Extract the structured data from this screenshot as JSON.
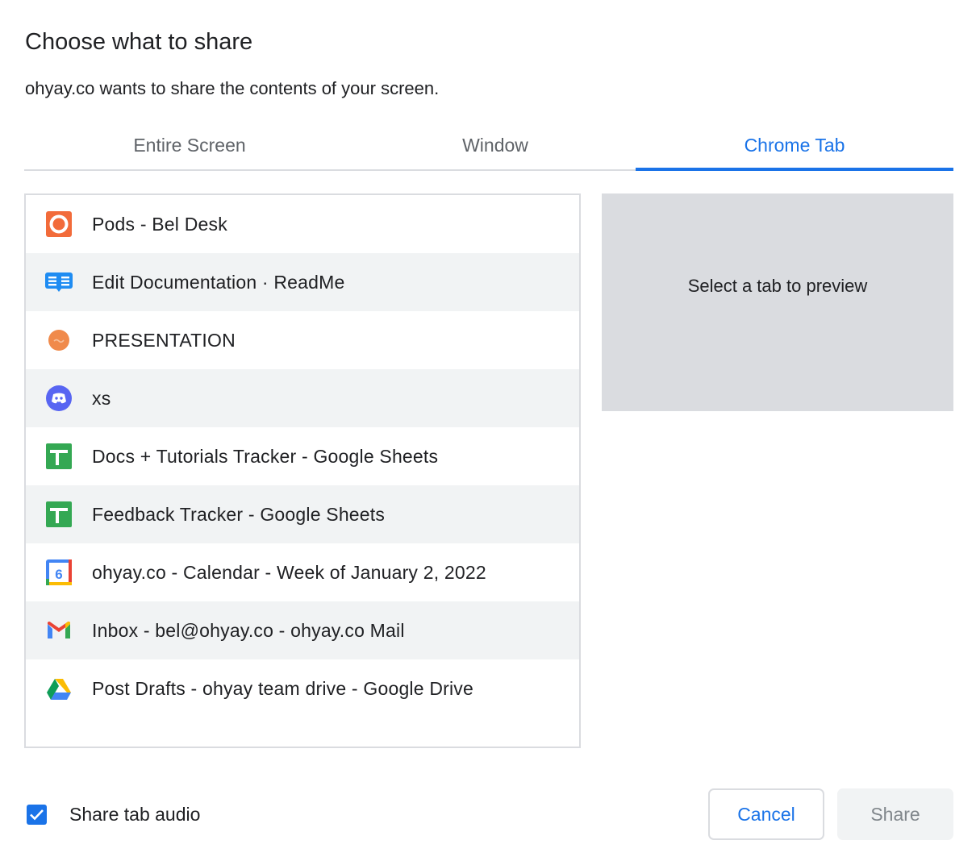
{
  "dialog": {
    "title": "Choose what to share",
    "subtitle": "ohyay.co wants to share the contents of your screen."
  },
  "tabs": [
    {
      "label": "Entire Screen",
      "active": false
    },
    {
      "label": "Window",
      "active": false
    },
    {
      "label": "Chrome Tab",
      "active": true
    }
  ],
  "browser_tabs": [
    {
      "label": "Pods - Bel Desk",
      "icon": "pods-icon"
    },
    {
      "label": "Edit Documentation · ReadMe",
      "icon": "readme-icon"
    },
    {
      "label": "PRESENTATION",
      "icon": "presentation-icon"
    },
    {
      "label": "xs",
      "icon": "discord-icon"
    },
    {
      "label": "Docs + Tutorials Tracker - Google Sheets",
      "icon": "google-sheets-icon"
    },
    {
      "label": "Feedback Tracker - Google Sheets",
      "icon": "google-sheets-icon"
    },
    {
      "label": "ohyay.co - Calendar - Week of January 2, 2022",
      "icon": "google-calendar-icon"
    },
    {
      "label": "Inbox - bel@ohyay.co - ohyay.co Mail",
      "icon": "gmail-icon"
    },
    {
      "label": "Post Drafts - ohyay team drive - Google Drive",
      "icon": "google-drive-icon"
    }
  ],
  "preview": {
    "placeholder": "Select a tab to preview"
  },
  "audio": {
    "label": "Share tab audio",
    "checked": true
  },
  "buttons": {
    "cancel": "Cancel",
    "share": "Share"
  },
  "colors": {
    "accent": "#1a73e8",
    "divider": "#dadce0",
    "preview_bg": "#dadce0",
    "alt_row": "#f1f3f4"
  }
}
